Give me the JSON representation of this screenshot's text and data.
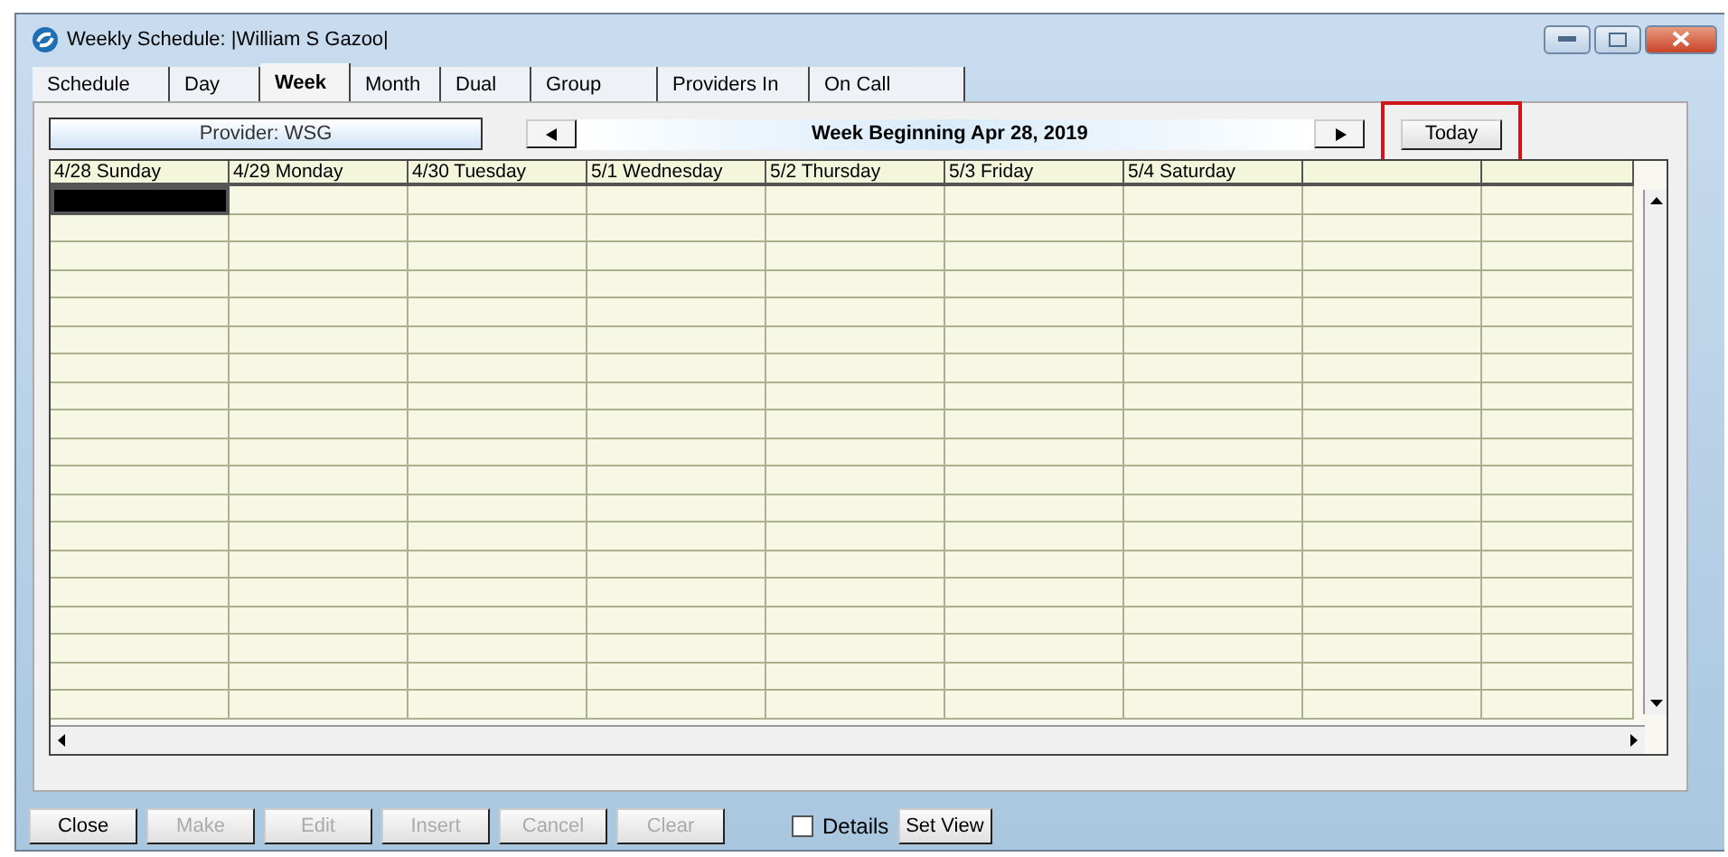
{
  "window": {
    "title": "Weekly Schedule: |William S Gazoo|"
  },
  "tabs": [
    {
      "label": "Schedule",
      "selected": false
    },
    {
      "label": "Day",
      "selected": false
    },
    {
      "label": "Week",
      "selected": true
    },
    {
      "label": "Month",
      "selected": false
    },
    {
      "label": "Dual",
      "selected": false
    },
    {
      "label": "Group",
      "selected": false
    },
    {
      "label": "Providers In",
      "selected": false
    },
    {
      "label": "On Call",
      "selected": false
    }
  ],
  "provider": "Provider: WSG",
  "week_label": "Week Beginning Apr 28, 2019",
  "today_button": {
    "label": "Today",
    "highlighted": true
  },
  "columns": [
    "4/28 Sunday",
    "4/29 Monday",
    "4/30 Tuesday",
    "5/1 Wednesday",
    "5/2 Thursday",
    "5/3 Friday",
    "5/4 Saturday"
  ],
  "rows": [
    {
      "selected": true
    },
    {
      "selected": false
    },
    {
      "selected": false
    },
    {
      "selected": false
    },
    {
      "selected": false
    },
    {
      "selected": false
    },
    {
      "selected": false
    },
    {
      "selected": false
    },
    {
      "selected": false
    },
    {
      "selected": false
    },
    {
      "selected": false
    },
    {
      "selected": false
    },
    {
      "selected": false
    },
    {
      "selected": false
    },
    {
      "selected": false
    },
    {
      "selected": false
    },
    {
      "selected": false
    },
    {
      "selected": false
    },
    {
      "selected": false
    }
  ],
  "buttons": [
    {
      "label": "Close",
      "disabled": false
    },
    {
      "label": "Make",
      "disabled": true
    },
    {
      "label": "Edit",
      "disabled": true
    },
    {
      "label": "Insert",
      "disabled": true
    },
    {
      "label": "Cancel",
      "disabled": true
    },
    {
      "label": "Clear",
      "disabled": true
    }
  ],
  "details": {
    "label": "Details",
    "checked": false
  },
  "set_view": {
    "label": "Set View"
  }
}
